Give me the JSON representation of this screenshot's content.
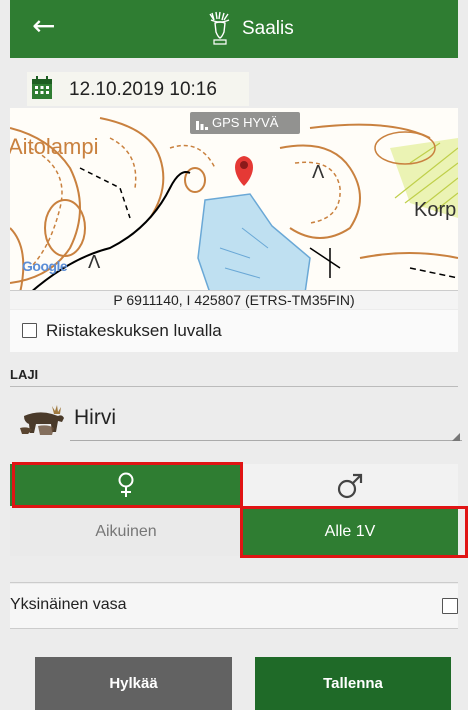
{
  "header": {
    "back_icon": "arrow-left-icon",
    "logo_icon": "moose-logo-icon",
    "title": "Saalis",
    "color": "#2f7d32"
  },
  "date": {
    "icon": "calendar-icon",
    "value": "12.10.2019 10:16"
  },
  "map": {
    "gps_status": "GPS HYVÄ",
    "place_label": "Aitolampi",
    "place_label_right": "Korp",
    "attribution": "Google",
    "coordinates": "P 6911140, I 425807 (ETRS-TM35FIN)"
  },
  "permit": {
    "label": "Riistakeskuksen luvalla",
    "checked": false
  },
  "species": {
    "section_label": "LAJI",
    "selected": "Hirvi",
    "icon": "moose-icon"
  },
  "gender": {
    "female_icon": "female-symbol-icon",
    "male_icon": "male-symbol-icon",
    "selected": "female"
  },
  "age": {
    "adult_label": "Aikuinen",
    "young_label": "Alle 1V",
    "selected": "young"
  },
  "solo_calf": {
    "label": "Yksinäinen vasa",
    "checked": false
  },
  "actions": {
    "reject_label": "Hylkää",
    "save_label": "Tallenna"
  },
  "colors": {
    "accent": "#2f7d32",
    "save_button": "#1f6a28",
    "reject_button": "#626262",
    "highlight": "#e01414"
  }
}
